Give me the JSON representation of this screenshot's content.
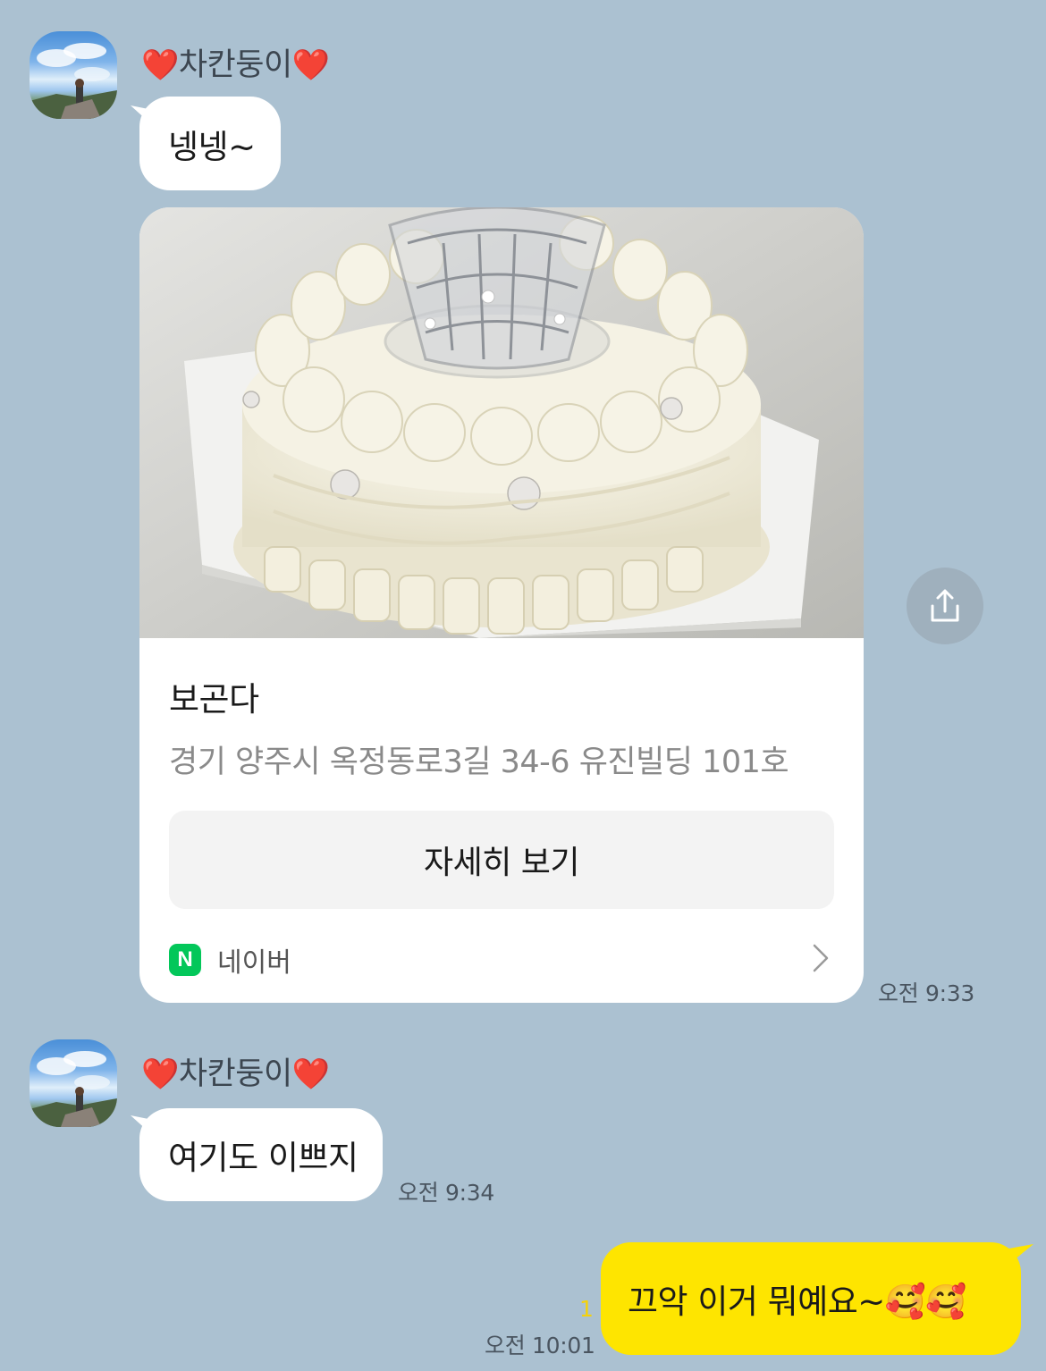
{
  "colors": {
    "background": "#abc1d1",
    "bubble_other": "#ffffff",
    "bubble_mine": "#fee500",
    "naver_green": "#03c75a",
    "unread_count": "#f5d20a"
  },
  "messages": [
    {
      "sender_heart_left": "❤️",
      "sender_name": "차칸둥이",
      "sender_heart_right": "❤️",
      "text": "넹넹~"
    },
    {
      "type": "link_card",
      "title": "보곤다",
      "address": "경기 양주시 옥정동로3길 34-6 유진빌딩 101호",
      "button_label": "자세히 보기",
      "source_badge": "N",
      "source_label": "네이버",
      "time": "오전 9:33",
      "share_icon": "share-icon"
    },
    {
      "sender_heart_left": "❤️",
      "sender_name": "차칸둥이",
      "sender_heart_right": "❤️",
      "text": "여기도 이쁘지",
      "time": "오전 9:34"
    },
    {
      "mine": true,
      "text": "끄악 이거 뭐예요~🥰🥰",
      "unread_count": "1",
      "time": "오전 10:01"
    }
  ]
}
